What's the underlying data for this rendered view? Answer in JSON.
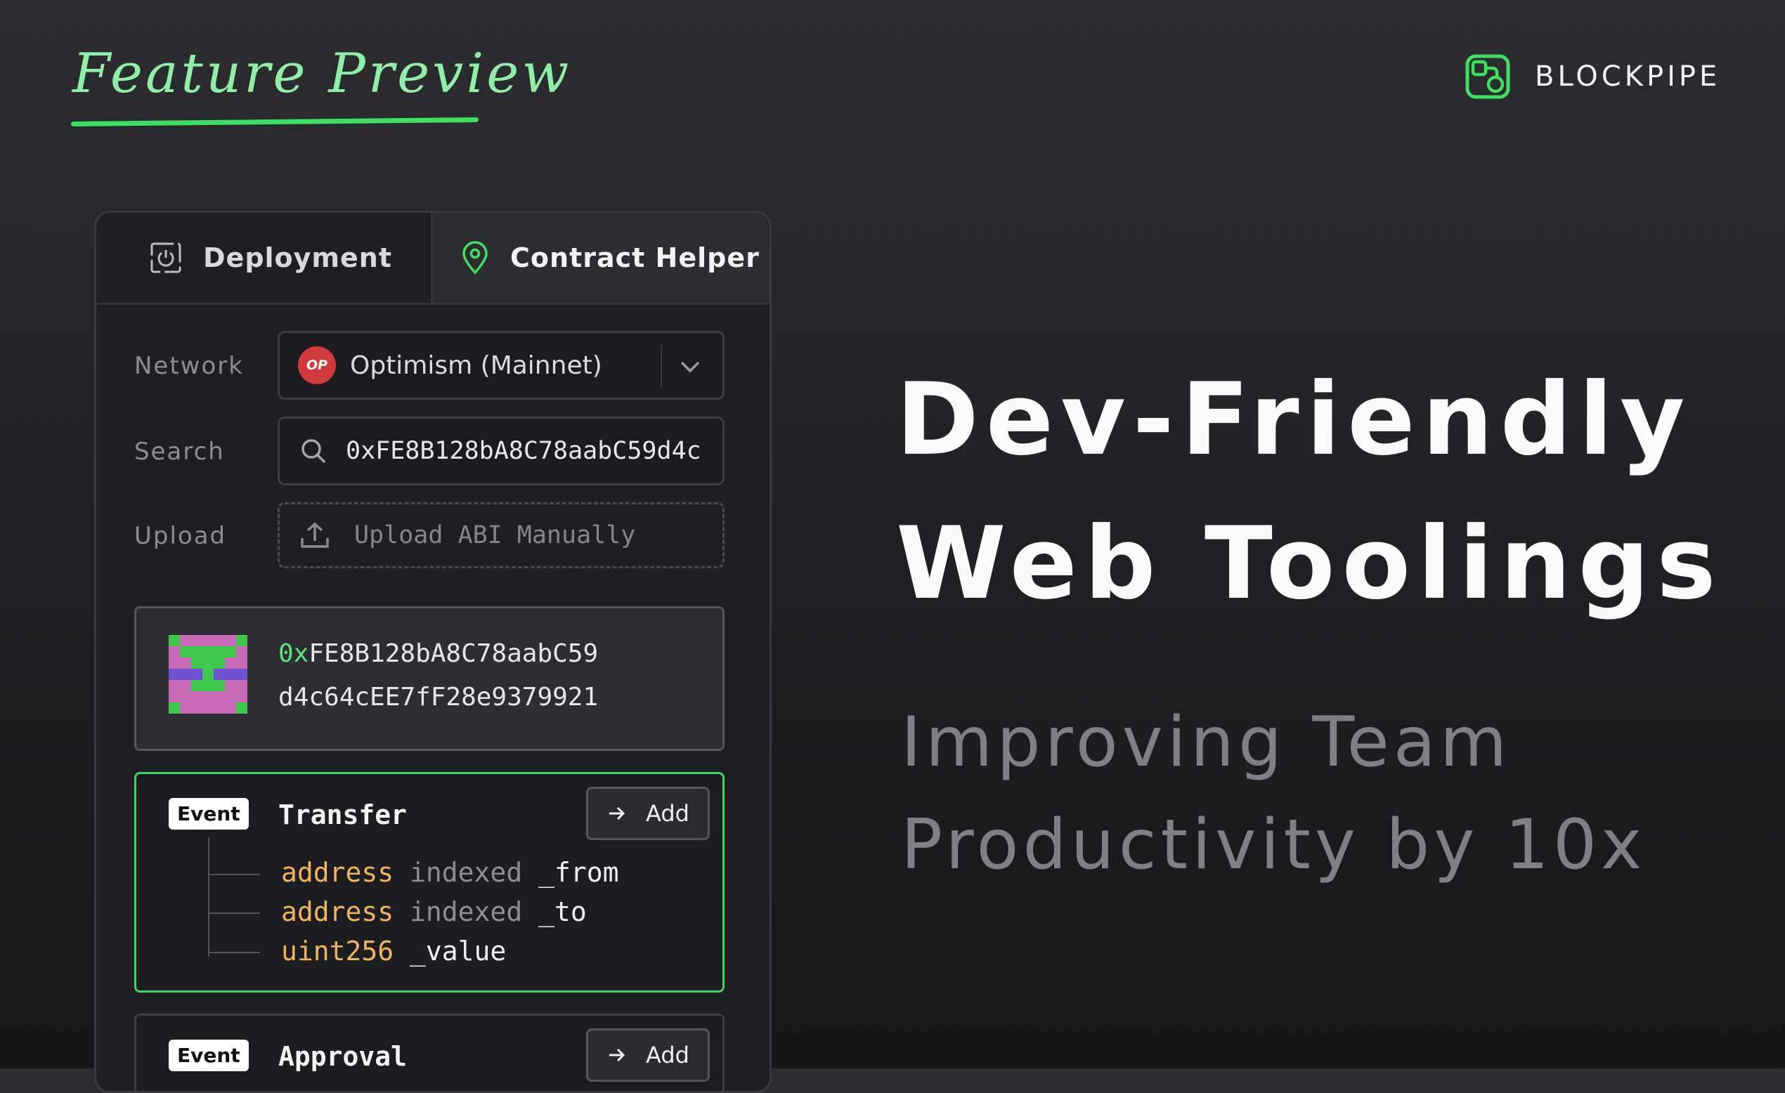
{
  "header": {
    "feature_label": "Feature Preview",
    "brand_name": "BLOCKPIPE",
    "brand_icon": "blockpipe-logo-icon",
    "accent_color": "#3ee05f"
  },
  "panel": {
    "tabs": [
      {
        "label": "Deployment",
        "icon": "power-icon",
        "active": false
      },
      {
        "label": "Contract Helper",
        "icon": "map-pin-icon",
        "active": true
      }
    ],
    "network": {
      "label": "Network",
      "badge": "OP",
      "value": "Optimism (Mainnet)"
    },
    "search": {
      "label": "Search",
      "value": "0xFE8B128bA8C78aabC59d4c"
    },
    "upload": {
      "label": "Upload",
      "placeholder": "Upload ABI Manually"
    },
    "address": {
      "prefix": "0x",
      "line1": "FE8B128bA8C78aabC59",
      "line2": "d4c64cEE7fF28e9379921"
    },
    "events": [
      {
        "badge": "Event",
        "name": "Transfer",
        "add_label": "Add",
        "params": [
          {
            "type": "address",
            "modifier": "indexed",
            "name": "_from"
          },
          {
            "type": "address",
            "modifier": "indexed",
            "name": "_to"
          },
          {
            "type": "uint256",
            "modifier": "",
            "name": "_value"
          }
        ]
      },
      {
        "badge": "Event",
        "name": "Approval",
        "add_label": "Add"
      }
    ]
  },
  "hero": {
    "headline_1": "Dev-Friendly",
    "headline_2": "Web Toolings",
    "subline_1": "Improving Team",
    "subline_2": "Productivity by 10x"
  }
}
